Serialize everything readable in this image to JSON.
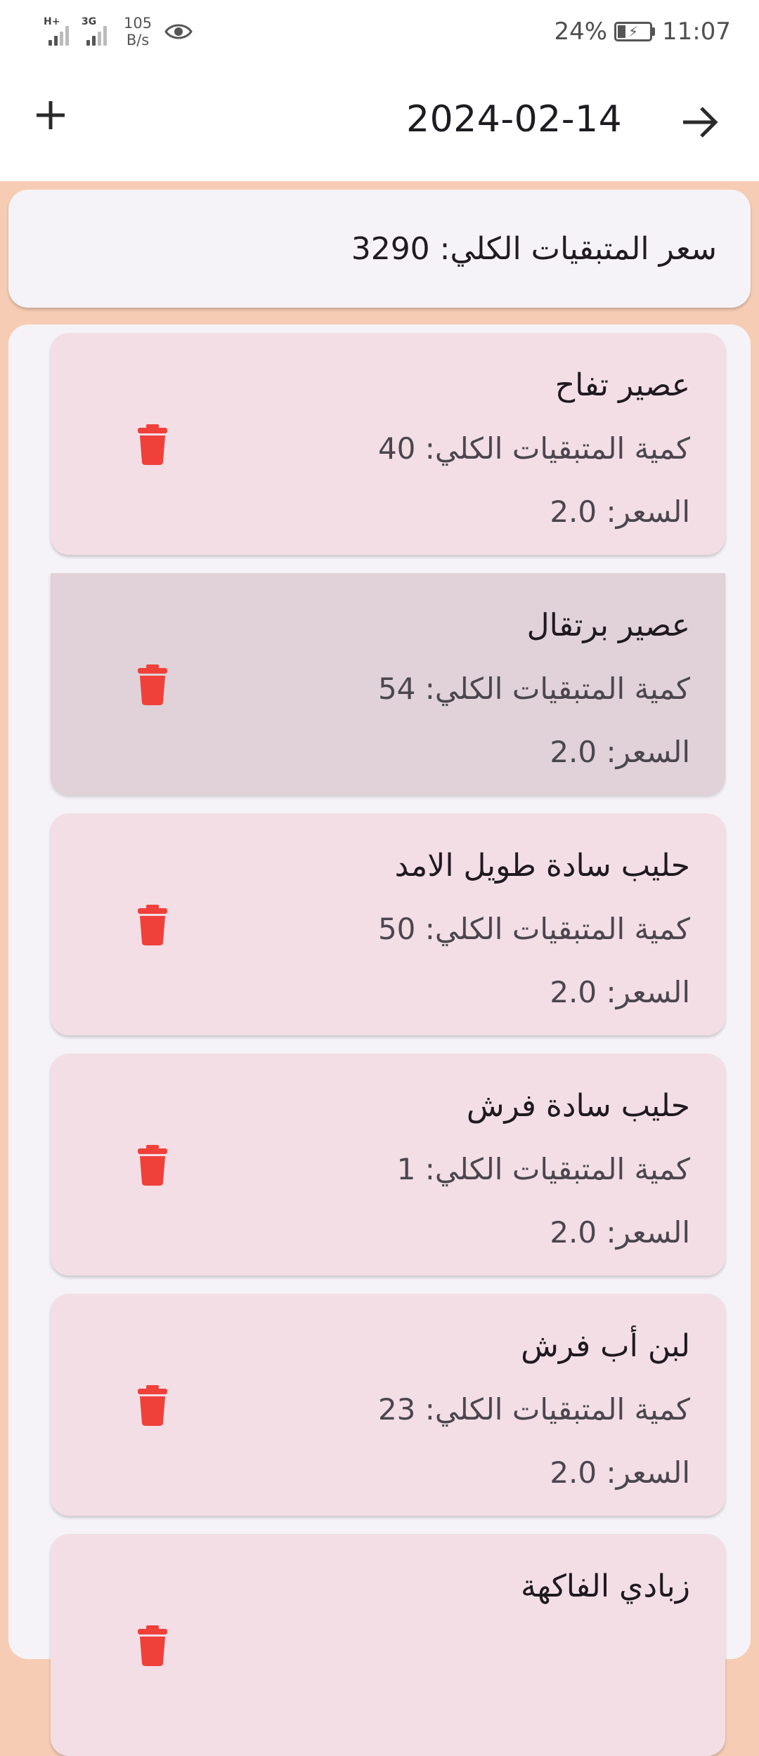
{
  "status_bar": {
    "network_1": "H+",
    "network_2": "3G",
    "speed_value": "105",
    "speed_unit": "B/s",
    "battery": "24%",
    "time": "11:07"
  },
  "app_bar": {
    "date": "2024-02-14",
    "add_icon": "plus-icon",
    "next_icon": "arrow-right-icon"
  },
  "summary": {
    "total_text": "سعر المتبقيات الكلي: 3290"
  },
  "items": [
    {
      "name": "عصير تفاح",
      "quantity": "كمية المتبقيات الكلي: 40",
      "price": "السعر: 2.0"
    },
    {
      "name": "عصير برتقال",
      "quantity": "كمية المتبقيات الكلي: 54",
      "price": "السعر: 2.0"
    },
    {
      "name": "حليب سادة طويل الامد",
      "quantity": "كمية المتبقيات الكلي: 50",
      "price": "السعر: 2.0"
    },
    {
      "name": "حليب سادة فرش",
      "quantity": "كمية المتبقيات الكلي: 1",
      "price": "السعر: 2.0"
    },
    {
      "name": "لبن أب فرش",
      "quantity": "كمية المتبقيات الكلي: 23",
      "price": "السعر: 2.0"
    },
    {
      "name": "زبادي الفاكهة",
      "quantity": "",
      "price": ""
    }
  ],
  "colors": {
    "background": "#f6cdb4",
    "card": "#f3dee6",
    "card_pressed": "#e0d2d8",
    "delete_icon": "#f0403a"
  }
}
